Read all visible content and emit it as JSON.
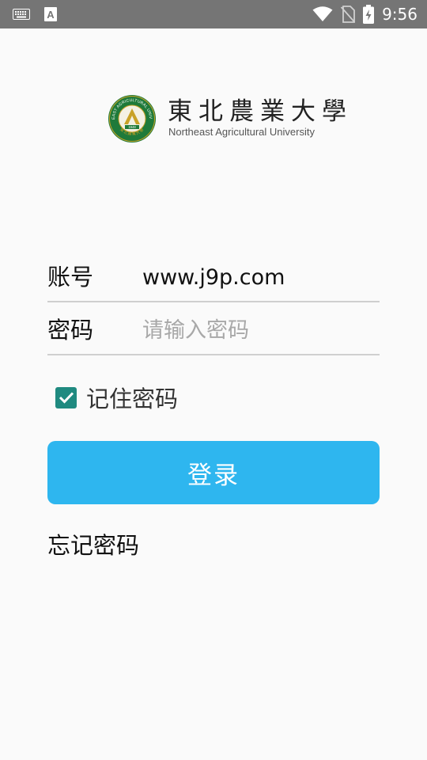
{
  "status_bar": {
    "time": "9:56",
    "icons": [
      "keyboard-icon",
      "a-notification-icon",
      "wifi-icon",
      "no-sim-icon",
      "battery-charging-icon"
    ]
  },
  "logo": {
    "name_cn": "東北農業大學",
    "name_en": "Northeast Agricultural University",
    "seal_ring_text": "NORTHEAST AGRICULTURAL UNIVERSITY",
    "seal_year": "1948",
    "seal_bottom_text": "東北農業大學"
  },
  "form": {
    "account_label": "账号",
    "account_value": "www.j9p.com",
    "password_label": "密码",
    "password_placeholder": "请输入密码",
    "remember_label": "记住密码",
    "remember_checked": true,
    "login_label": "登录",
    "forgot_label": "忘记密码"
  },
  "colors": {
    "status_bar_bg": "#757575",
    "page_bg": "#fafafa",
    "button_bg": "#2eb6ef",
    "checkbox_bg": "#1f8a80",
    "seal_green": "#1f7a3a",
    "seal_gold": "#c9a227"
  }
}
